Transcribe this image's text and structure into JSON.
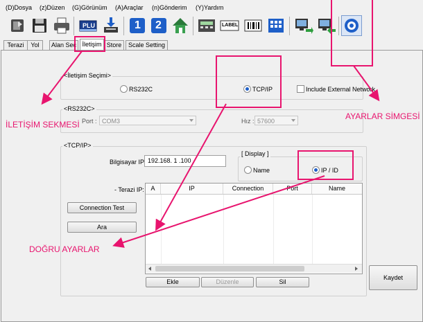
{
  "menu": [
    "(D)Dosya",
    "(z)Düzen",
    "(G)Görünüm",
    "(A)Araçlar",
    "(n)Gönderim",
    "(Y)Yardım"
  ],
  "toolbar": {
    "plu_label": "PLU",
    "one_label": "1",
    "two_label": "2",
    "label_label": "LABEL"
  },
  "tabs": [
    "Terazi",
    "Yol",
    "Alan Seç",
    "İletişim",
    "Store",
    "Scale Setting"
  ],
  "active_tab": "İletişim",
  "comm_select": {
    "legend": "İletişim Seçimi",
    "rs232c_label": "RS232C",
    "tcpip_label": "TCP/IP",
    "selected": "TCP/IP",
    "include_external_label": "Include External Network",
    "include_external_checked": false
  },
  "rs232c": {
    "legend": "RS232C",
    "port_label": "Port :",
    "port_value": "COM3",
    "speed_label": "Hız :",
    "speed_value": "57600"
  },
  "tcpip": {
    "legend": "TCP/IP",
    "computer_ip_label": "Bilgisayar IP:",
    "computer_ip_value": "192.168. 1 .100",
    "display_legend": "Display",
    "name_label": "Name",
    "ipid_label": "IP / ID",
    "display_selected": "IP / ID",
    "scale_ip_label": "- Terazi IP:",
    "connection_test_label": "Connection Test",
    "search_label": "Ara",
    "columns": [
      "A",
      "IP",
      "Connection",
      "Port",
      "Name"
    ],
    "add_label": "Ekle",
    "edit_label": "Düzenle",
    "delete_label": "Sil"
  },
  "save_label": "Kaydet",
  "annotations": {
    "tab": "İLETİŞİM SEKMESİ",
    "settings_icon": "AYARLAR SİMGESİ",
    "correct_settings": "DOĞRU AYARLAR",
    "color": "#e8146e"
  }
}
